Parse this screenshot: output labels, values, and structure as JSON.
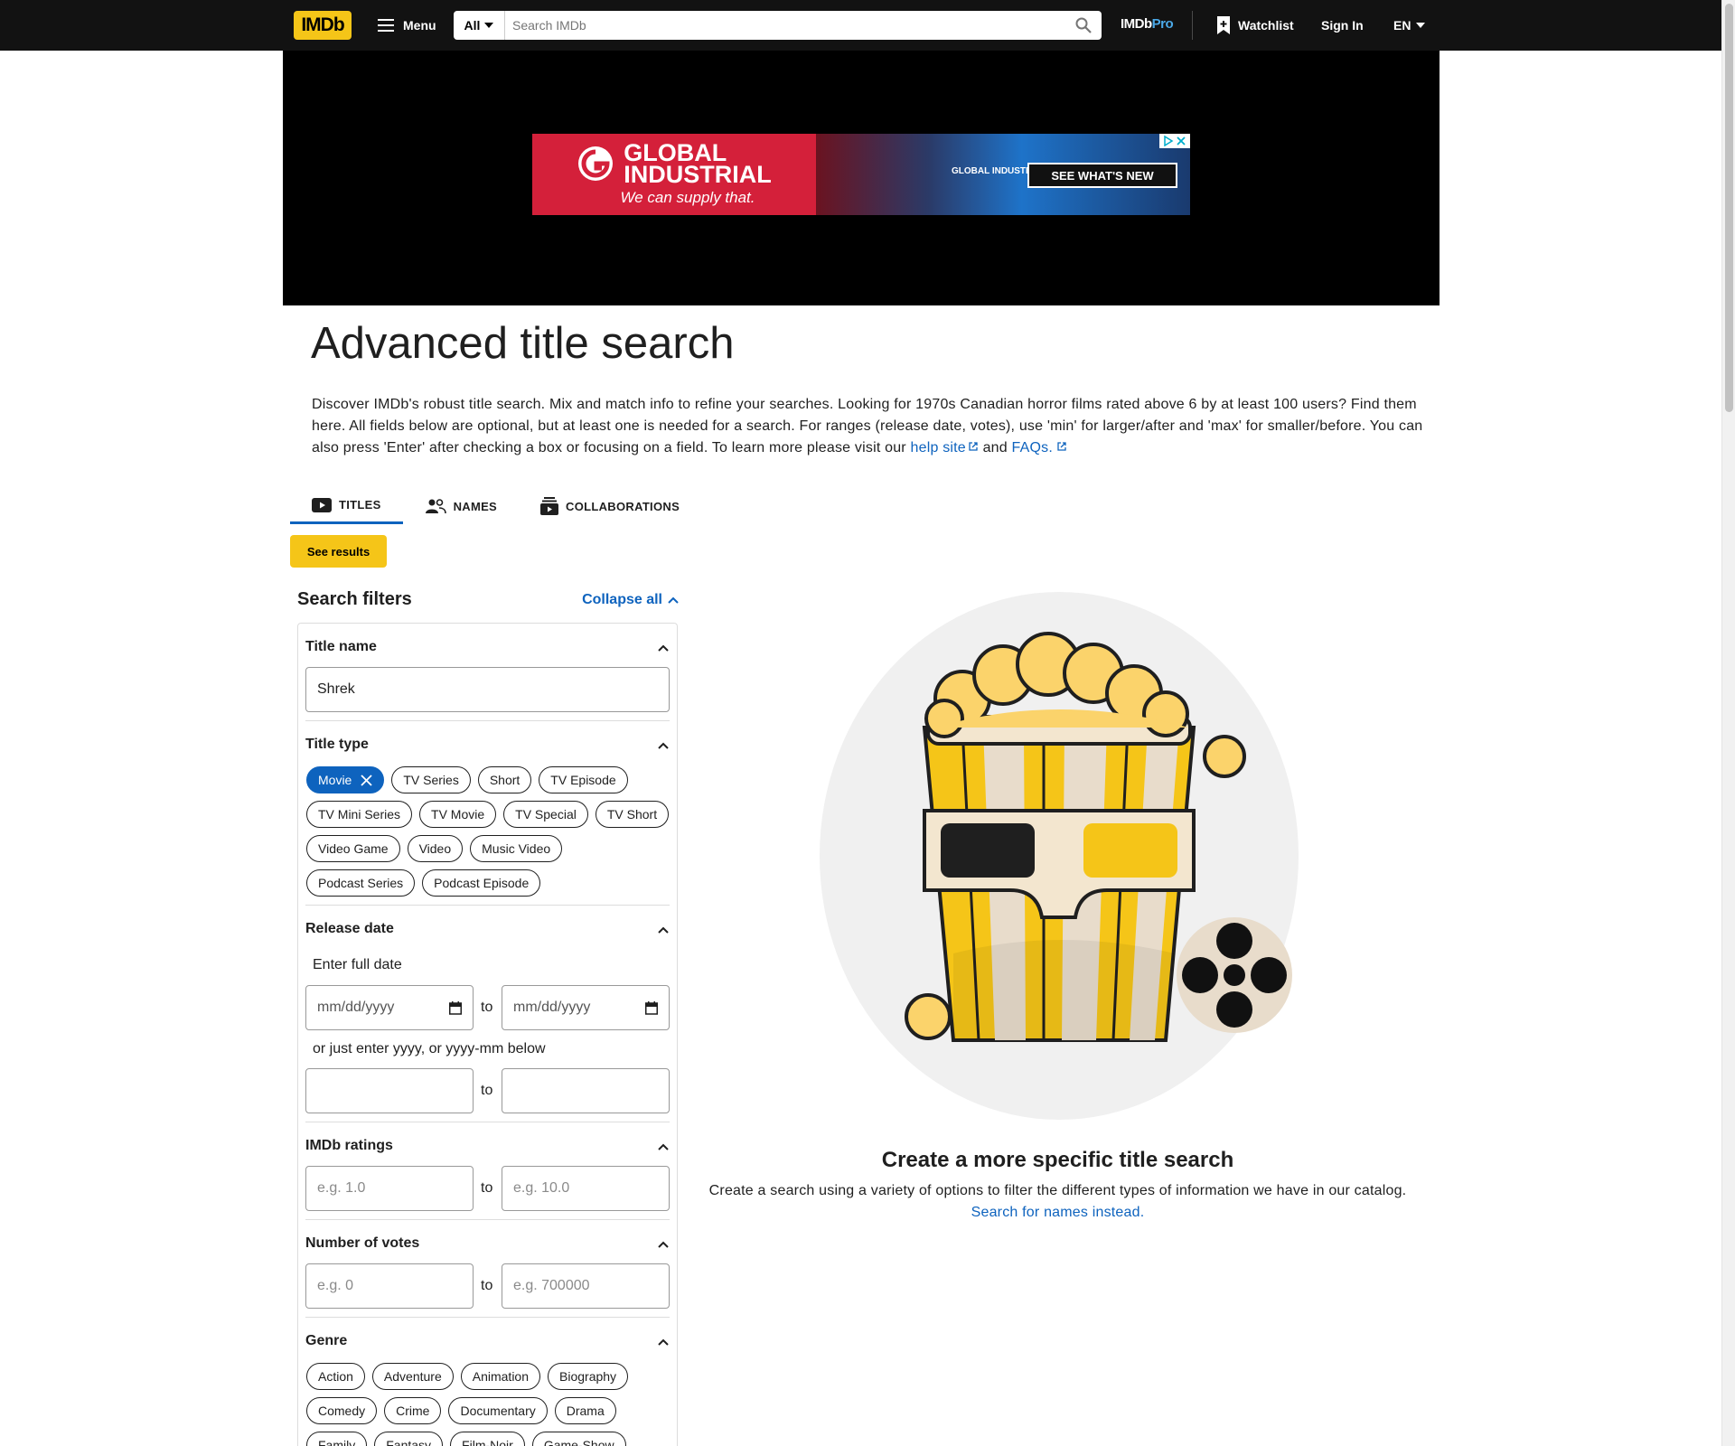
{
  "header": {
    "logo": "IMDb",
    "menu_label": "Menu",
    "search_category": "All",
    "search_placeholder": "Search IMDb",
    "imdbpro_a": "IMDb",
    "imdbpro_b": "Pro",
    "watchlist_label": "Watchlist",
    "signin_label": "Sign In",
    "language": "EN"
  },
  "ad": {
    "brand_line1": "GLOBAL",
    "brand_line2": "INDUSTRIAL",
    "tagline": "We can supply that.",
    "mini_brand": "GLOBAL INDUSTRIAL",
    "cta": "SEE WHAT'S NEW"
  },
  "page": {
    "title": "Advanced title search",
    "intro": "Discover IMDb's robust title search. Mix and match info to refine your searches. Looking for 1970s Canadian horror films rated above 6 by at least 100 users? Find them here. All fields below are optional, but at least one is needed for a search. For ranges (release date, votes), use 'min' for larger/after and 'max' for smaller/before. You can also press 'Enter' after checking a box or focusing on a field. To learn more please visit our",
    "help_link": "help site",
    "and_text": "and",
    "faq_link": "FAQs."
  },
  "tabs": [
    {
      "label": "TITLES",
      "active": true
    },
    {
      "label": "NAMES",
      "active": false
    },
    {
      "label": "COLLABORATIONS",
      "active": false
    }
  ],
  "see_results_label": "See results",
  "filters": {
    "heading": "Search filters",
    "collapse_all": "Collapse all",
    "title_name": {
      "label": "Title name",
      "value": "Shrek"
    },
    "title_type": {
      "label": "Title type",
      "options": [
        "Movie",
        "TV Series",
        "Short",
        "TV Episode",
        "TV Mini Series",
        "TV Movie",
        "TV Special",
        "TV Short",
        "Video Game",
        "Video",
        "Music Video",
        "Podcast Series",
        "Podcast Episode"
      ],
      "selected": "Movie"
    },
    "release_date": {
      "label": "Release date",
      "full_date_hint": "Enter full date",
      "date_placeholder": "mm/dd/yyyy",
      "to": "to",
      "partial_hint": "or just enter yyyy, or yyyy-mm below"
    },
    "ratings": {
      "label": "IMDb ratings",
      "min_placeholder": "e.g. 1.0",
      "max_placeholder": "e.g. 10.0"
    },
    "votes": {
      "label": "Number of votes",
      "min_placeholder": "e.g. 0",
      "max_placeholder": "e.g. 700000"
    },
    "genre": {
      "label": "Genre",
      "options": [
        "Action",
        "Adventure",
        "Animation",
        "Biography",
        "Comedy",
        "Crime",
        "Documentary",
        "Drama",
        "Family",
        "Fantasy",
        "Film-Noir",
        "Game-Show"
      ]
    }
  },
  "empty_state": {
    "title": "Create a more specific title search",
    "description": "Create a search using a variety of options to filter the different types of information we have in our catalog.",
    "link": "Search for names instead."
  },
  "colors": {
    "accent_yellow": "#f5c518",
    "link_blue": "#0e63be",
    "nav_bg": "#121212"
  }
}
